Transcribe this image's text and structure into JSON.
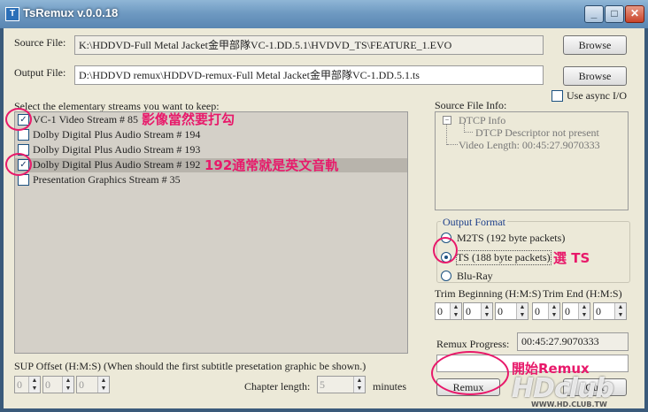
{
  "window": {
    "title": "TsRemux v.0.0.18",
    "icon": "app-icon",
    "min": "_",
    "max": "□",
    "close": "✕"
  },
  "source": {
    "label": "Source File:",
    "value": "K:\\HDDVD-Full Metal Jacket金甲部隊VC-1.DD.5.1\\HVDVD_TS\\FEATURE_1.EVO",
    "browse": "Browse"
  },
  "output": {
    "label": "Output File:",
    "value": "D:\\HDDVD remux\\HDDVD-remux-Full Metal Jacket金甲部隊VC-1.DD.5.1.ts",
    "browse": "Browse"
  },
  "async": {
    "label": "Use async I/O",
    "checked": false
  },
  "streams": {
    "label": "Select the elementary streams you want to keep:",
    "items": [
      {
        "label": "VC-1 Video Stream # 85",
        "checked": true
      },
      {
        "label": "Dolby Digital Plus Audio Stream # 194",
        "checked": false
      },
      {
        "label": "Dolby Digital Plus Audio Stream # 193",
        "checked": false
      },
      {
        "label": "Dolby Digital Plus Audio Stream # 192",
        "checked": true
      },
      {
        "label": "Presentation Graphics Stream # 35",
        "checked": false
      }
    ]
  },
  "info": {
    "label": "Source File Info:",
    "tree": [
      "DTCP Info",
      "DTCP Descriptor not present",
      "Video Length: 00:45:27.9070333"
    ]
  },
  "format": {
    "label": "Output Format",
    "options": [
      {
        "label": "M2TS (192 byte packets)",
        "selected": false
      },
      {
        "label": "TS (188 byte packets)",
        "selected": true
      },
      {
        "label": "Blu-Ray",
        "selected": false
      }
    ]
  },
  "trim": {
    "begin_label": "Trim Beginning (H:M:S)",
    "end_label": "Trim End  (H:M:S)",
    "values": [
      "0",
      "0",
      "0",
      "0",
      "0",
      "0"
    ]
  },
  "progress": {
    "label": "Remux Progress:",
    "value": "00:45:27.9070333"
  },
  "sup": {
    "label": "SUP Offset (H:M:S) (When should the first subtitle presetation graphic be shown.)",
    "values": [
      "0",
      "0",
      "0"
    ]
  },
  "chapter": {
    "label": "Chapter length:",
    "value": "5",
    "unit": "minutes"
  },
  "buttons": {
    "remux": "Remux",
    "quit": "Quit"
  },
  "annotations": {
    "video": "影像當然要打勾",
    "audio": "192通常就是英文音軌",
    "ts": "選 TS",
    "remux": "開始Remux"
  },
  "watermark": {
    "logo": "HDclub",
    "url": "WWW.HD.CLUB.TW"
  },
  "colors": {
    "accent": "#e8196a",
    "title_bar": "#6f9ac2",
    "window_bg": "#ece9d8"
  }
}
